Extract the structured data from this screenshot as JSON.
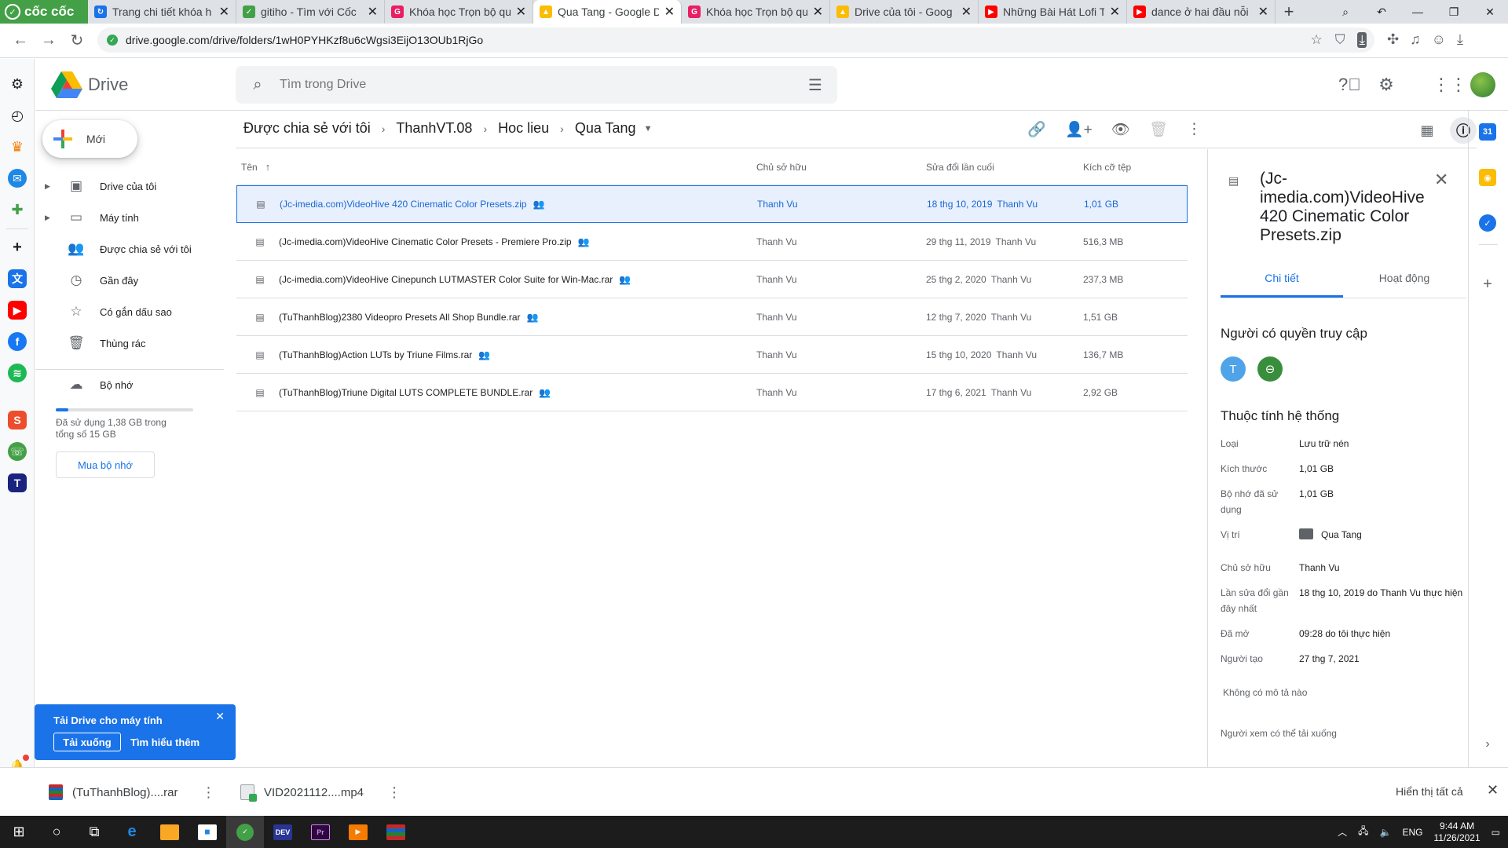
{
  "browser": {
    "brand": "cốc cốc",
    "tabs": [
      {
        "title": "Trang chi tiết khóa h",
        "color": "#1a73e8",
        "glyph": "↻"
      },
      {
        "title": "gitiho - Tìm với Cốc",
        "color": "#43a047",
        "glyph": "✓"
      },
      {
        "title": "Khóa học Trọn bộ qu",
        "color": "#e91e63",
        "glyph": "G"
      },
      {
        "title": "Qua Tang - Google D",
        "color": "#fbbc04",
        "glyph": "▲",
        "active": true
      },
      {
        "title": "Khóa học Trọn bộ qu",
        "color": "#e91e63",
        "glyph": "G"
      },
      {
        "title": "Drive của tôi - Goog",
        "color": "#fbbc04",
        "glyph": "▲"
      },
      {
        "title": "Những Bài Hát Lofi T",
        "color": "#ff0000",
        "glyph": "▶"
      },
      {
        "title": "dance ở hai đầu nỗi",
        "color": "#ff0000",
        "glyph": "▶"
      }
    ],
    "url": "drive.google.com/drive/folders/1wH0PYHKzf8u6cWgsi3EijO13OUb1RjGo"
  },
  "drive": {
    "logo_text": "Drive",
    "search_placeholder": "Tìm trong Drive",
    "new_label": "Mới",
    "nav": [
      {
        "label": "Drive của tôi",
        "icon": "drive-icon",
        "glyph": "▣",
        "caret": true
      },
      {
        "label": "Máy tính",
        "icon": "computer-icon",
        "glyph": "▭",
        "caret": true
      },
      {
        "label": "Được chia sẻ với tôi",
        "icon": "shared-icon",
        "glyph": "👥",
        "caret": false
      },
      {
        "label": "Gần đây",
        "icon": "clock-icon",
        "glyph": "◷",
        "caret": false
      },
      {
        "label": "Có gắn dấu sao",
        "icon": "star-icon",
        "glyph": "☆",
        "caret": false
      },
      {
        "label": "Thùng rác",
        "icon": "trash-icon",
        "glyph": "🗑",
        "caret": false
      }
    ],
    "storage": {
      "label": "Bộ nhớ",
      "used_text": "Đã sử dụng 1,38 GB trong tổng số 15 GB",
      "used_fraction": 0.092,
      "buy_label": "Mua bộ nhớ"
    },
    "breadcrumb": [
      "Được chia sẻ với tôi",
      "ThanhVT.08",
      "Hoc lieu",
      "Qua Tang"
    ],
    "columns": {
      "name": "Tên",
      "owner": "Chủ sở hữu",
      "modified": "Sửa đổi lần cuối",
      "size": "Kích cỡ tệp"
    },
    "files": [
      {
        "name": "(Jc-imedia.com)VideoHive 420 Cinematic Color Presets.zip",
        "owner": "Thanh Vu",
        "modified": "18 thg 10, 2019",
        "modified_by": "Thanh Vu",
        "size": "1,01 GB",
        "selected": true
      },
      {
        "name": "(Jc-imedia.com)VideoHive Cinematic Color Presets - Premiere Pro.zip",
        "owner": "Thanh Vu",
        "modified": "29 thg 11, 2019",
        "modified_by": "Thanh Vu",
        "size": "516,3 MB"
      },
      {
        "name": "(Jc-imedia.com)VideoHive Cinepunch LUTMASTER Color Suite for Win-Mac.rar",
        "owner": "Thanh Vu",
        "modified": "25 thg 2, 2020",
        "modified_by": "Thanh Vu",
        "size": "237,3 MB"
      },
      {
        "name": "(TuThanhBlog)2380 Videopro Presets All Shop Bundle.rar",
        "owner": "Thanh Vu",
        "modified": "12 thg 7, 2020",
        "modified_by": "Thanh Vu",
        "size": "1,51 GB"
      },
      {
        "name": "(TuThanhBlog)Action LUTs by Triune Films.rar",
        "owner": "Thanh Vu",
        "modified": "15 thg 10, 2020",
        "modified_by": "Thanh Vu",
        "size": "136,7 MB"
      },
      {
        "name": "(TuThanhBlog)Triune Digital LUTS COMPLETE BUNDLE.rar",
        "owner": "Thanh Vu",
        "modified": "17 thg 6, 2021",
        "modified_by": "Thanh Vu",
        "size": "2,92 GB"
      }
    ],
    "details": {
      "title": "(Jc-imedia.com)VideoHive 420 Cinematic Color Presets.zip",
      "tab_details": "Chi tiết",
      "tab_activity": "Hoạt động",
      "access_heading": "Người có quyền truy cập",
      "access_initial": "T",
      "props_heading": "Thuộc tính hệ thống",
      "props": {
        "type_k": "Loại",
        "type_v": "Lưu trữ nén",
        "size_k": "Kích thước",
        "size_v": "1,01 GB",
        "used_k": "Bộ nhớ đã sử dụng",
        "used_v": "1,01 GB",
        "loc_k": "Vị trí",
        "loc_v": "Qua Tang",
        "owner_k": "Chủ sở hữu",
        "owner_v": "Thanh Vu",
        "lastmod_k": "Lần sửa đổi gần đây nhất",
        "lastmod_v": "18 thg 10, 2019 do Thanh Vu thực hiện",
        "opened_k": "Đã mở",
        "opened_v": "09:28 do tôi thực hiện",
        "creator_k": "Người tạo",
        "creator_v": "27 thg 7, 2021"
      },
      "no_description": "Không có mô tả nào",
      "viewer_download": "Người xem có thể tải xuống"
    },
    "toast": {
      "title": "Tải Drive cho máy tính",
      "download": "Tải xuống",
      "more": "Tìm hiểu thêm"
    }
  },
  "downloads": {
    "items": [
      {
        "name": "(TuThanhBlog)....rar"
      },
      {
        "name": "VID2021112....mp4"
      }
    ],
    "show_all": "Hiển thị tất cả"
  },
  "taskbar": {
    "lang": "ENG",
    "time": "9:44 AM",
    "date": "11/26/2021"
  },
  "colors": {
    "accent": "#1a73e8",
    "selected_bg": "#e8f0fe",
    "brand_green": "#43a047"
  }
}
